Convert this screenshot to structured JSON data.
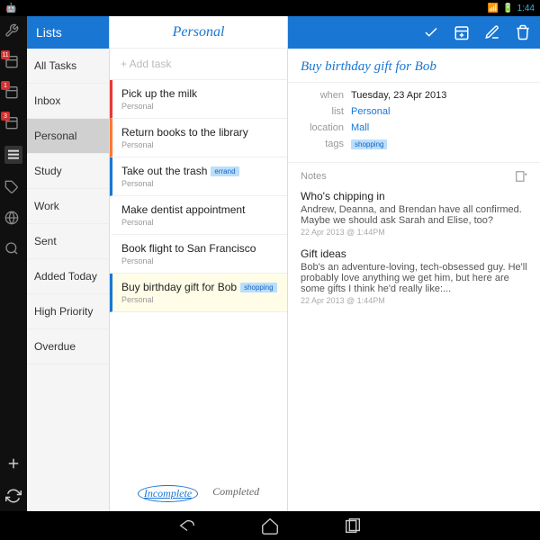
{
  "statusbar": {
    "time": "1:44"
  },
  "lists_header": "Lists",
  "lists": [
    {
      "label": "All Tasks"
    },
    {
      "label": "Inbox"
    },
    {
      "label": "Personal",
      "selected": true
    },
    {
      "label": "Study"
    },
    {
      "label": "Work"
    },
    {
      "label": "Sent"
    },
    {
      "label": "Added Today"
    },
    {
      "label": "High Priority"
    },
    {
      "label": "Overdue"
    }
  ],
  "iconrail_badges": {
    "cal1": "11",
    "cal2": "1",
    "cal3": "3"
  },
  "tasks_header": "Personal",
  "add_task_placeholder": "+ Add task",
  "tasks": [
    {
      "title": "Pick up the milk",
      "sub": "Personal",
      "color": "red"
    },
    {
      "title": "Return books to the library",
      "sub": "Personal",
      "color": "orange"
    },
    {
      "title": "Take out the trash",
      "sub": "Personal",
      "color": "blue",
      "tag": "errand"
    },
    {
      "title": "Make dentist appointment",
      "sub": "Personal",
      "color": ""
    },
    {
      "title": "Book flight to San Francisco",
      "sub": "Personal",
      "color": ""
    },
    {
      "title": "Buy birthday gift for Bob",
      "sub": "Personal",
      "color": "blue",
      "tag": "shopping",
      "selected": true
    }
  ],
  "tasks_tabs": {
    "incomplete": "Incomplete",
    "completed": "Completed"
  },
  "detail": {
    "title": "Buy birthday gift for Bob",
    "fields": {
      "when_label": "when",
      "when_value": "Tuesday, 23 Apr 2013",
      "list_label": "list",
      "list_value": "Personal",
      "location_label": "location",
      "location_value": "Mall",
      "tags_label": "tags",
      "tags_value": "shopping"
    },
    "notes_label": "Notes",
    "notes": [
      {
        "title": "Who's chipping in",
        "body": "Andrew, Deanna, and Brendan have all confirmed. Maybe we should ask Sarah and Elise, too?",
        "ts": "22 Apr 2013 @ 1:44PM"
      },
      {
        "title": "Gift ideas",
        "body": "Bob's an adventure-loving, tech-obsessed guy. He'll probably love anything we get him, but here are some gifts I think he'd really like:...",
        "ts": "22 Apr 2013 @ 1:44PM"
      }
    ]
  }
}
